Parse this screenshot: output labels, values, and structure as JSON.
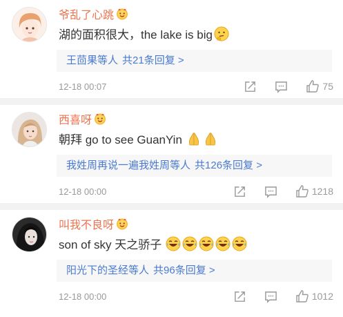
{
  "comments": [
    {
      "user": "爷乱了心跳",
      "text": "湖的面积很大，the lake is big",
      "emoji": [
        "thinking-emoji"
      ],
      "replies_who": "王茴果等人",
      "replies_count": "共21条回复 >",
      "time": "12-18 00:07",
      "likes": "75"
    },
    {
      "user": "西喜呀",
      "text": "朝拜 go to see GuanYin",
      "emoji": [
        "pray-emoji",
        "pray-emoji"
      ],
      "replies_who": "我姓周再说一遍我姓周等人",
      "replies_count": "共126条回复 >",
      "time": "12-18 00:00",
      "likes": "1218"
    },
    {
      "user": "叫我不良呀",
      "text": "son of sky 天之骄子",
      "emoji": [
        "laughing-emoji",
        "laughing-emoji",
        "laughing-emoji",
        "laughing-emoji",
        "laughing-emoji"
      ],
      "replies_who": "阳光下的圣经等人",
      "replies_count": "共96条回复 >",
      "time": "12-18 00:00",
      "likes": "1012"
    }
  ],
  "colors": {
    "username": "#eb7350",
    "link": "#4a7ad1",
    "meta": "#999999",
    "reply_bg": "#f7f7f7",
    "divider": "#f2f2f2"
  }
}
